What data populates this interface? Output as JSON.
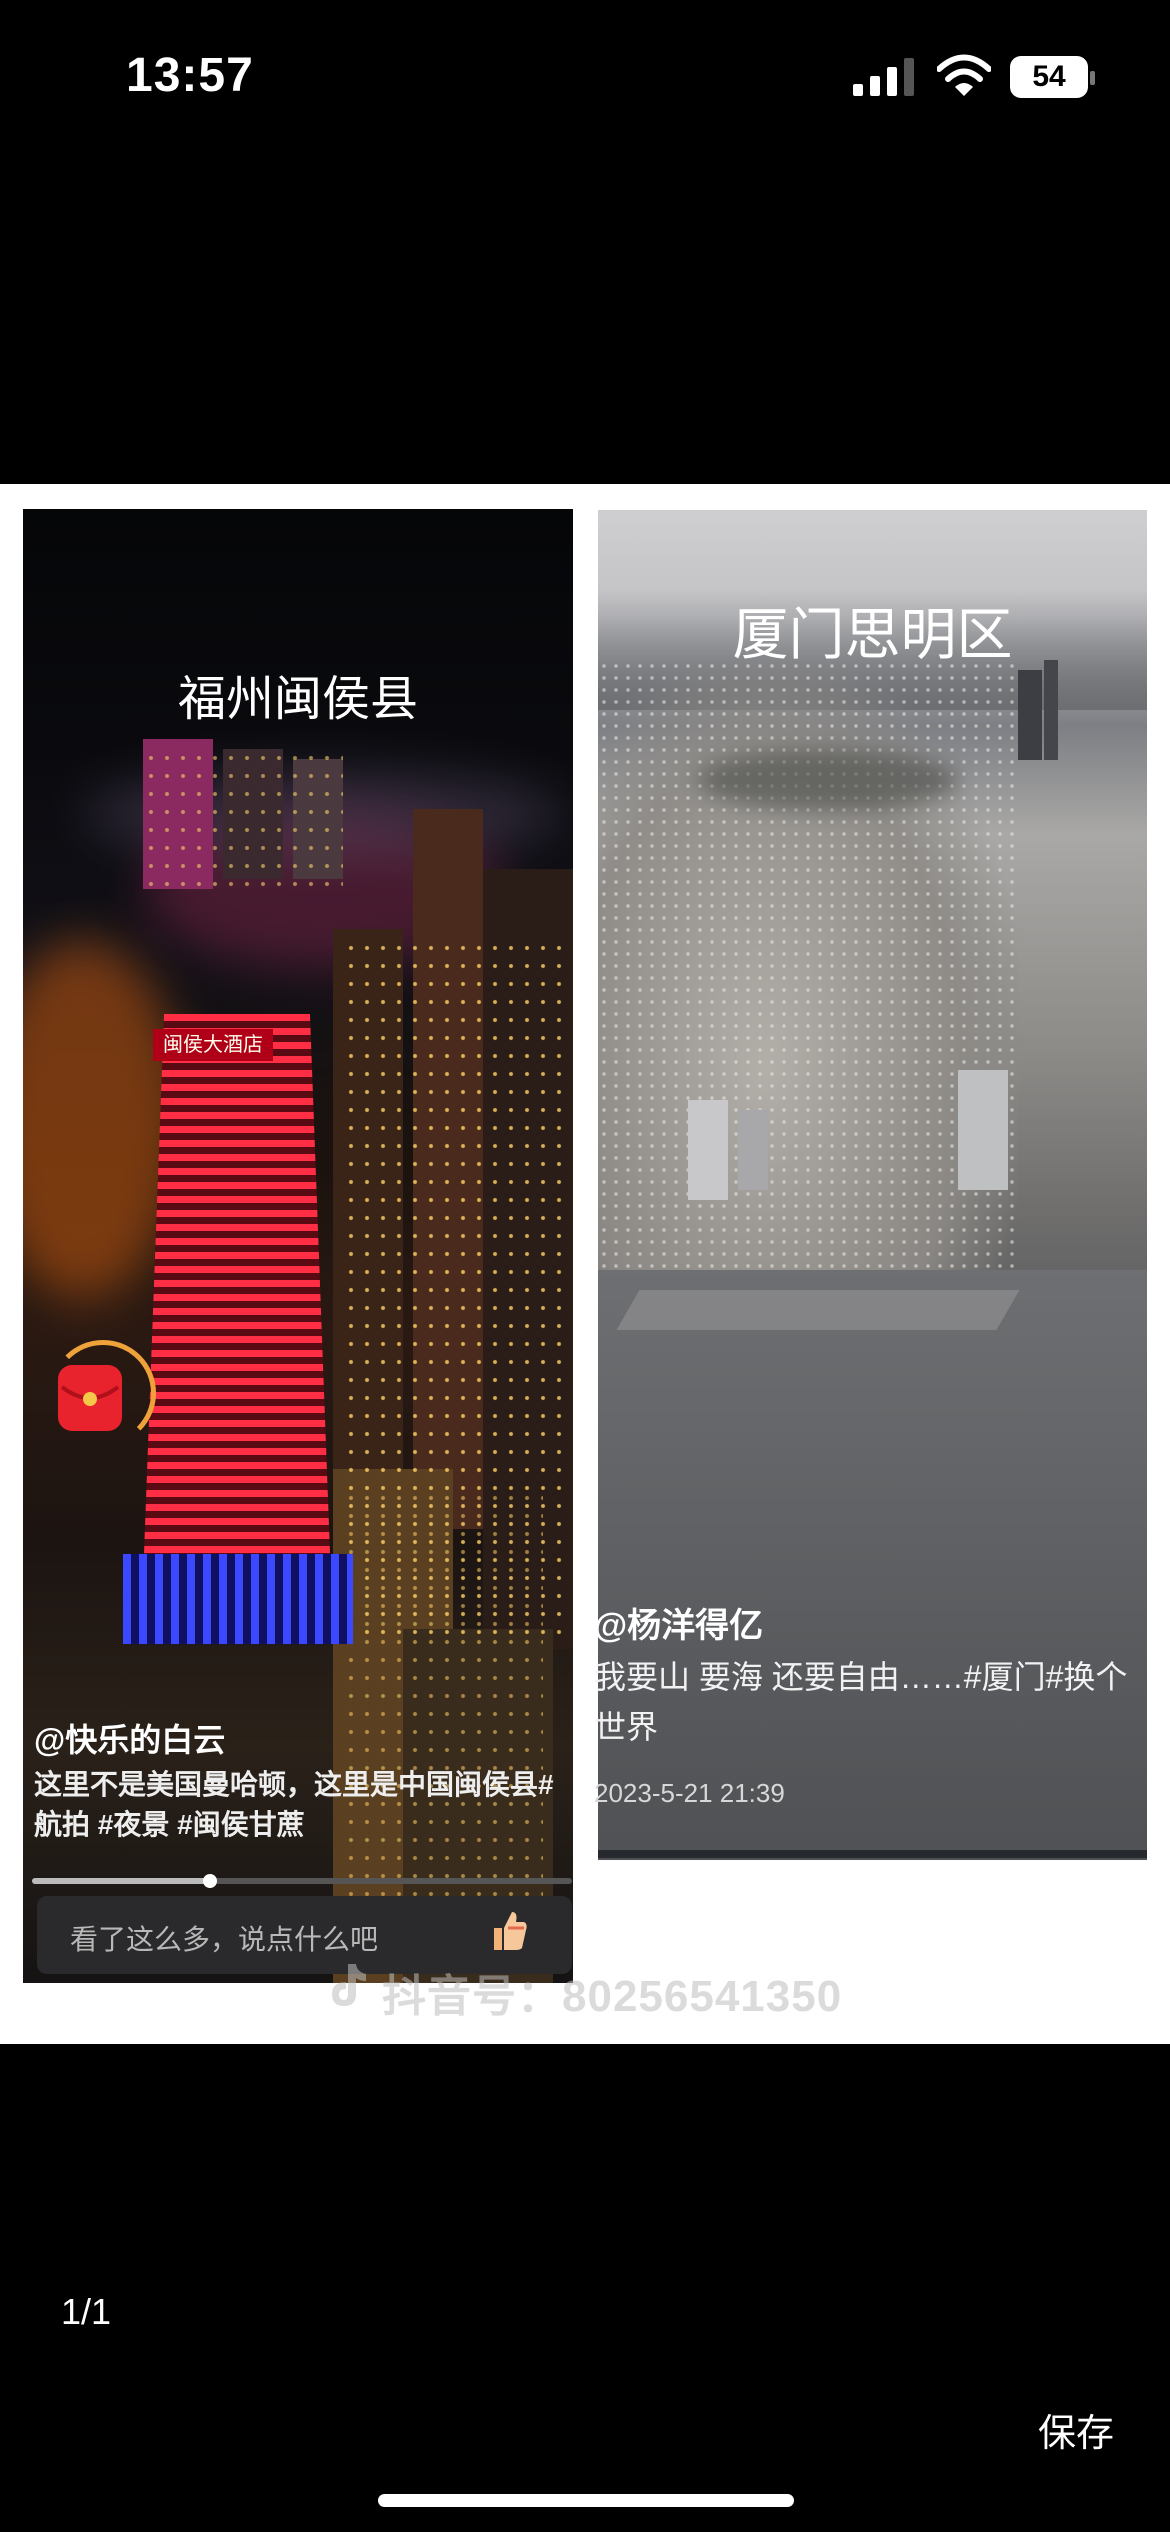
{
  "status_bar": {
    "time": "13:57",
    "battery": "54"
  },
  "left_post": {
    "title": "福州闽侯县",
    "sign_text": "闽侯大酒店",
    "username": "@快乐的白云",
    "caption": "这里不是美国曼哈顿，这里是中国闽侯县#航拍 #夜景 #闽侯甘蔗",
    "comment_placeholder": "看了这么多，说点什么吧",
    "progress": 0.33
  },
  "right_post": {
    "title": "厦门思明区",
    "username": "@杨洋得亿",
    "caption": "我要山 要海 还要自由……#厦门#换个世界",
    "date": "2023-5-21 21:39"
  },
  "watermark": "抖音号：80256541350",
  "viewer": {
    "page_counter": "1/1",
    "save_label": "保存"
  },
  "colors": {
    "background": "#000000",
    "card": "#ffffff",
    "tower_red": "#ff2e45",
    "tower_blue": "#3a49ff"
  }
}
